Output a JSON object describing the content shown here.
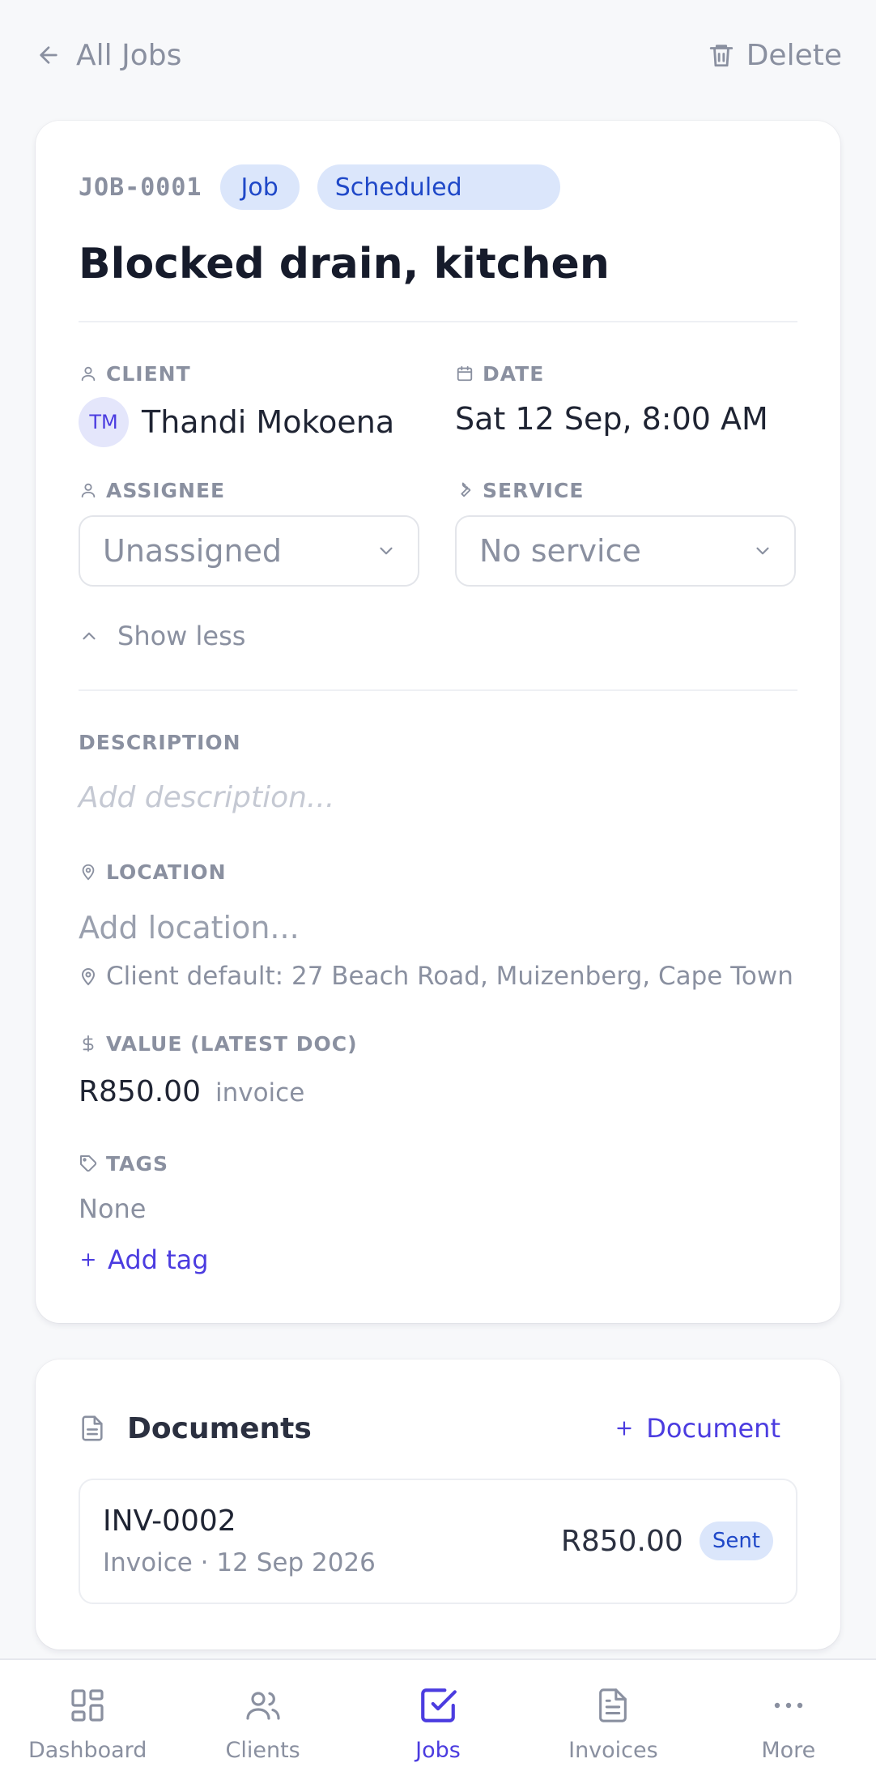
{
  "header": {
    "back_label": "All Jobs",
    "delete_label": "Delete"
  },
  "job": {
    "id": "JOB-0001",
    "type_badge": "Job",
    "status_badge": "Scheduled",
    "title": "Blocked drain, kitchen"
  },
  "fields": {
    "client_label": "CLIENT",
    "client_initials": "TM",
    "client_name": "Thandi Mokoena",
    "date_label": "DATE",
    "date_value": "Sat 12 Sep, 8:00 AM",
    "assignee_label": "ASSIGNEE",
    "assignee_value": "Unassigned",
    "service_label": "SERVICE",
    "service_value": "No service",
    "show_less_label": "Show less",
    "description_label": "DESCRIPTION",
    "description_placeholder": "Add description...",
    "location_label": "LOCATION",
    "location_placeholder": "Add location...",
    "location_default": "Client default: 27 Beach Road, Muizenberg, Cape Town",
    "value_label": "VALUE (LATEST DOC)",
    "value_amount": "R850.00",
    "value_kind": "invoice",
    "tags_label": "TAGS",
    "tags_value": "None",
    "add_tag_label": "Add tag"
  },
  "documents": {
    "title": "Documents",
    "add_label": "Document",
    "items": [
      {
        "number": "INV-0002",
        "meta": "Invoice · 12 Sep 2026",
        "amount": "R850.00",
        "status": "Sent"
      }
    ]
  },
  "nav": {
    "items": [
      {
        "label": "Dashboard",
        "icon": "dashboard-grid-icon",
        "active": false
      },
      {
        "label": "Clients",
        "icon": "users-icon",
        "active": false
      },
      {
        "label": "Jobs",
        "icon": "check-square-icon",
        "active": true
      },
      {
        "label": "Invoices",
        "icon": "document-icon",
        "active": false
      },
      {
        "label": "More",
        "icon": "more-dots-icon",
        "active": false
      }
    ]
  },
  "colors": {
    "accent": "#4b3ce0",
    "badge_bg": "#dbe6fb",
    "badge_text": "#1f48c8",
    "muted": "#8a90a0"
  }
}
